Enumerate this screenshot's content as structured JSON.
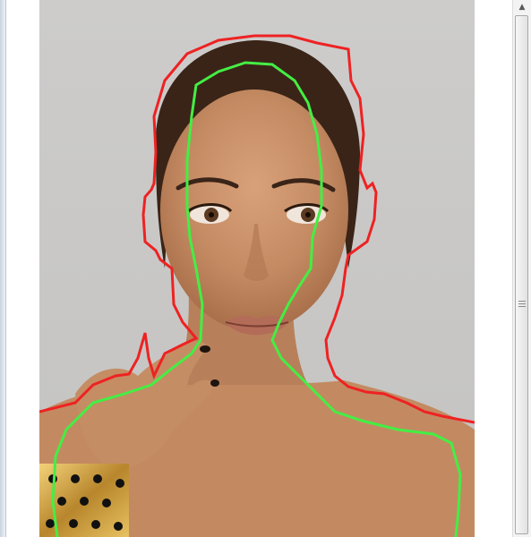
{
  "window": {
    "title": ""
  },
  "canvas": {
    "image_subject": "portrait-photo",
    "overlay_colors": {
      "outer_contour": "#ee2222",
      "inner_contour": "#44ee44"
    },
    "background_color": "#c9c8c6"
  },
  "scrollbar": {
    "up_icon": "arrow-up-icon",
    "grip_icon": "grip-icon"
  }
}
